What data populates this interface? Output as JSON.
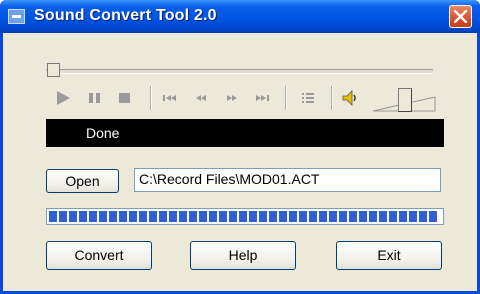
{
  "window": {
    "title": "Sound Convert Tool 2.0"
  },
  "status": {
    "text": "Done"
  },
  "file": {
    "open_label": "Open",
    "path": "C:\\Record  Files\\MOD01.ACT"
  },
  "progress": {
    "value": 1.0
  },
  "buttons": {
    "convert": "Convert",
    "help": "Help",
    "exit": "Exit"
  },
  "playback": {
    "position": 0.0,
    "volume": 0.5
  },
  "colors": {
    "titlebar": "#0054e3",
    "progress": "#2f5fd0",
    "close": "#d2532f",
    "status_bg": "#000000"
  }
}
